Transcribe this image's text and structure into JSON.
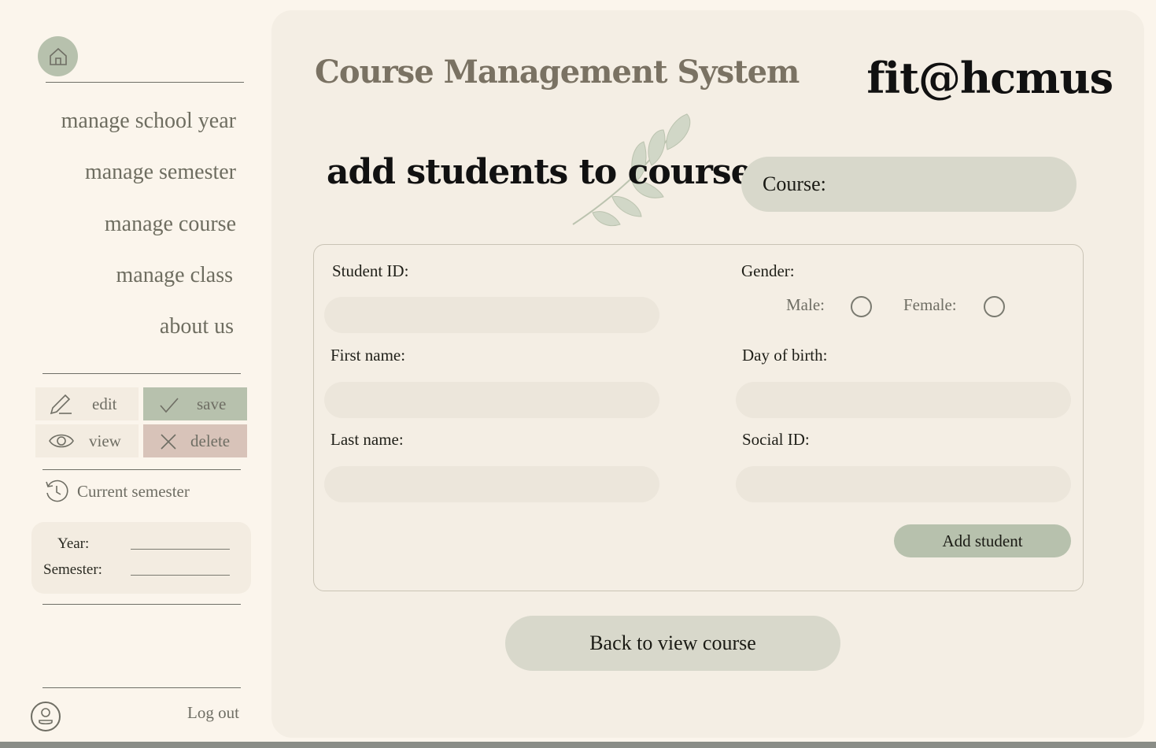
{
  "sidebar": {
    "home_icon": "home-icon",
    "nav": [
      {
        "label": "manage school year"
      },
      {
        "label": "manage semester"
      },
      {
        "label": "manage course"
      },
      {
        "label": "manage class"
      },
      {
        "label": "about us"
      }
    ],
    "actions": {
      "edit": "edit",
      "save": "save",
      "view": "view",
      "delete": "delete"
    },
    "current_semester": {
      "label": "Current semester",
      "year_label": "Year:",
      "semester_label": "Semester:"
    },
    "logout": "Log out"
  },
  "header": {
    "app_title": "Course Management System",
    "brand": "fit@hcmus"
  },
  "page": {
    "title": "add students to course",
    "course_label": "Course:"
  },
  "form": {
    "student_id": "Student ID:",
    "first_name": "First name:",
    "last_name": "Last name:",
    "gender": "Gender:",
    "male": "Male:",
    "female": "Female:",
    "dob": "Day of birth:",
    "social_id": "Social ID:",
    "add_button": "Add student"
  },
  "back_button": "Back to view course",
  "colors": {
    "background": "#fbf5ec",
    "panel": "#f4eee4",
    "sage": "#b7c1ad",
    "pill": "#d8d8cb",
    "delete": "#d8c3b9"
  }
}
